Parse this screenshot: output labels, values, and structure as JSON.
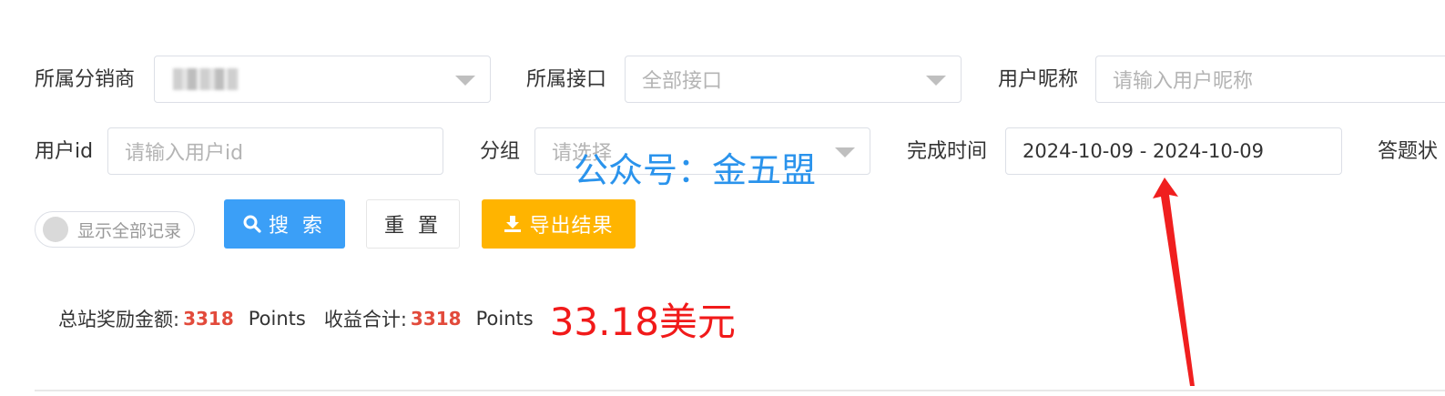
{
  "filters": {
    "distributor_label": "所属分销商",
    "interface_label": "所属接口",
    "interface_value": "全部接口",
    "nickname_label": "用户昵称",
    "nickname_placeholder": "请输入用户昵称",
    "userid_label": "用户id",
    "userid_placeholder": "请输入用户id",
    "group_label": "分组",
    "group_placeholder": "请选择",
    "time_label": "完成时间",
    "time_value": "2024-10-09 - 2024-10-09",
    "answer_label": "答题状"
  },
  "toggle": {
    "label": "显示全部记录"
  },
  "buttons": {
    "search": "搜 索",
    "reset": "重 置",
    "export": "导出结果"
  },
  "stats": {
    "total_label": "总站奖励金额:",
    "total_value": "3318",
    "total_unit": "Points",
    "income_label": "收益合计:",
    "income_value": "3318",
    "income_unit": "Points",
    "usd_value": "33.18美元"
  },
  "watermark": "公众号：金五盟",
  "colors": {
    "primary": "#3b9ff7",
    "warning": "#ffb400",
    "danger": "#e24a3b",
    "annotation": "#f11a1a"
  }
}
